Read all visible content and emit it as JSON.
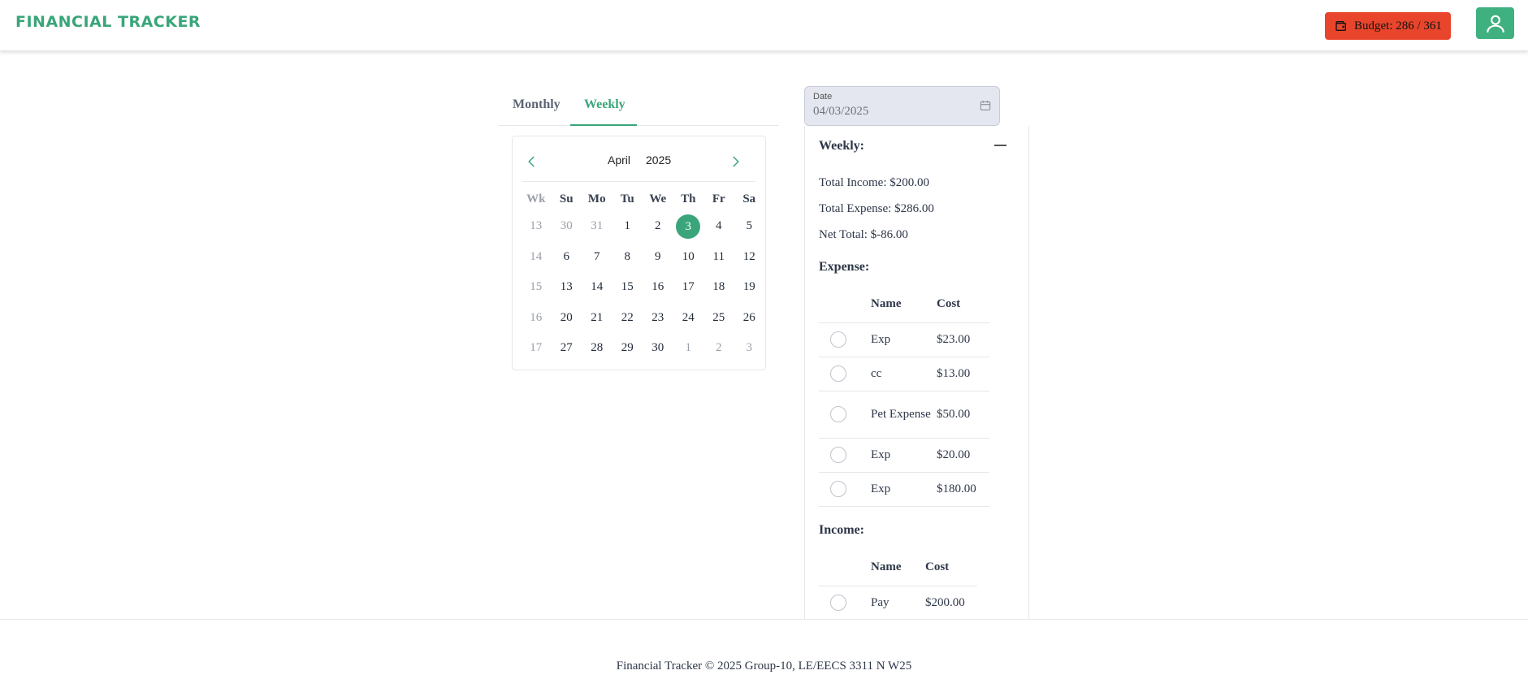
{
  "header": {
    "brand": "FINANCIAL TRACKER",
    "budget_label": "Budget: 286 / 361",
    "budget_color": "#e8452c",
    "brand_color": "#3aa57a"
  },
  "tabs": [
    {
      "label": "Monthly",
      "active": false
    },
    {
      "label": "Weekly",
      "active": true
    }
  ],
  "calendar": {
    "month": "April",
    "year": "2025",
    "headers": [
      "Wk",
      "Su",
      "Mo",
      "Tu",
      "We",
      "Th",
      "Fr",
      "Sa"
    ],
    "weeks": [
      {
        "wk": "13",
        "days": [
          "30",
          "31",
          "1",
          "2",
          "3",
          "4",
          "5"
        ]
      },
      {
        "wk": "14",
        "days": [
          "6",
          "7",
          "8",
          "9",
          "10",
          "11",
          "12"
        ]
      },
      {
        "wk": "15",
        "days": [
          "13",
          "14",
          "15",
          "16",
          "17",
          "18",
          "19"
        ]
      },
      {
        "wk": "16",
        "days": [
          "20",
          "21",
          "22",
          "23",
          "24",
          "25",
          "26"
        ]
      },
      {
        "wk": "17",
        "days": [
          "27",
          "28",
          "29",
          "30",
          "1",
          "2",
          "3"
        ]
      }
    ],
    "selected": "3"
  },
  "date_field": {
    "label": "Date",
    "value": "04/03/2025"
  },
  "weekly": {
    "title": "Weekly:",
    "total_income": "Total Income: $200.00",
    "total_expense": "Total Expense: $286.00",
    "net_total": "Net Total: $-86.00",
    "expense_title": "Expense:",
    "income_title": "Income:",
    "columns": {
      "name": "Name",
      "cost": "Cost"
    },
    "expenses": [
      {
        "name": "Exp",
        "cost": "$23.00"
      },
      {
        "name": "cc",
        "cost": "$13.00"
      },
      {
        "name": "Pet Expense",
        "cost": "$50.00"
      },
      {
        "name": "Exp",
        "cost": "$20.00"
      },
      {
        "name": "Exp",
        "cost": "$180.00"
      }
    ],
    "income": [
      {
        "name": "Pay",
        "cost": "$200.00"
      }
    ]
  },
  "footer": {
    "text": "Financial Tracker © 2025 Group-10, LE/EECS 3311 N W25"
  }
}
